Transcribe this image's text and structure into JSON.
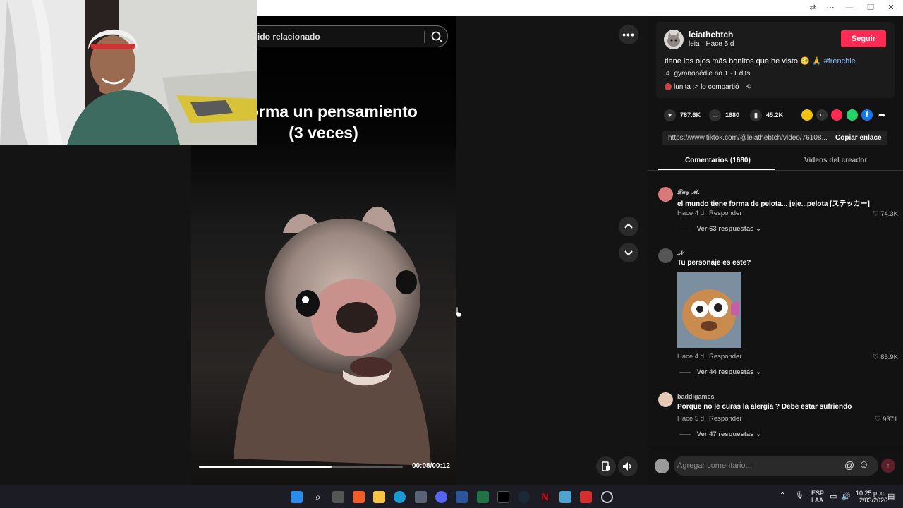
{
  "video": {
    "search_placeholder": "ido relacionado",
    "caption_line1": "forma un pensamiento",
    "caption_line2": "(3 veces)",
    "time": "00:08/00:12",
    "progress": 0.65
  },
  "author": {
    "username": "leiathebtch",
    "sub": "leia · Hace 5 d",
    "follow_label": "Seguir",
    "description": "tiene los ojos más bonitos que he visto 🥺 🙏 ",
    "hashtag": "#frenchie",
    "music": "gymnopédie no.1 - Edits",
    "shared_by": "lunita :> lo compartió"
  },
  "stats": {
    "likes": "787.6K",
    "comments": "1680",
    "saves": "45.2K"
  },
  "link": {
    "url": "https://www.tiktok.com/@leiathebtch/video/76108...",
    "copy_label": "Copiar enlace"
  },
  "tabs": {
    "comments": "Comentarios (1680)",
    "creator_videos": "Videos del creador"
  },
  "comments": [
    {
      "name": "𝓛𝓾𝔃 𝓜.",
      "text": "el mundo tiene forma de pelota... jeje...pelota [ステッカー]",
      "time": "Hace 4 d",
      "reply": "Responder",
      "likes": "74.3K",
      "replies": "Ver 63 respuestas"
    },
    {
      "name": "𝓝",
      "text": "Tu personaje es este?",
      "time": "Hace 4 d",
      "reply": "Responder",
      "likes": "85.9K",
      "replies": "Ver 44 respuestas"
    },
    {
      "name": "baddigames",
      "text": "Porque no le curas la alergia ? Debe estar sufriendo",
      "time": "Hace 5 d",
      "reply": "Responder",
      "likes": "9371",
      "replies": "Ver 47 respuestas"
    }
  ],
  "comment_box": {
    "placeholder": "Agregar comentario..."
  },
  "taskbar": {
    "lang1": "ESP",
    "lang2": "LAA",
    "time": "10:25 p. m.",
    "date": "2/03/2026"
  },
  "colors": {
    "accent": "#fe2c55",
    "hashtag": "#8ab4ff"
  }
}
